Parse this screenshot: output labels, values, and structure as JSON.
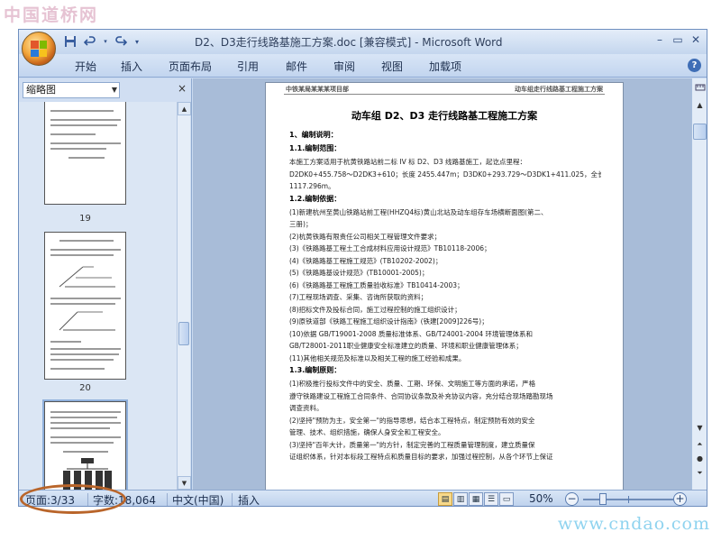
{
  "watermark_top": "中国道桥网",
  "watermark_bottom": "www.cndao.com",
  "window": {
    "title": "D2、D3走行线路基施工方案.doc [兼容模式] - Microsoft Word",
    "qat": {
      "save_icon": "save-icon",
      "undo_icon": "undo-icon",
      "redo_icon": "redo-icon",
      "customize_icon": "customize-qat-icon"
    },
    "controls": {
      "minimize": "–",
      "restore": "▭",
      "close": "✕"
    }
  },
  "ribbon": {
    "tabs": [
      "开始",
      "插入",
      "页面布局",
      "引用",
      "邮件",
      "审阅",
      "视图",
      "加载项"
    ],
    "help": "?"
  },
  "thumbnails": {
    "pane_title": "缩略图",
    "close": "×",
    "page_numbers": [
      "19",
      "20"
    ]
  },
  "document": {
    "header_left": "中铁某局某某某项目部",
    "header_right": "动车组走行线路基工程施工方案",
    "title": "动车组 D2、D3 走行线路基工程施工方案",
    "lines": [
      {
        "h": true,
        "text": "1、编制说明："
      },
      {
        "h": true,
        "text": "1.1.编制范围："
      },
      {
        "h": false,
        "text": "    本施工方案适用于杭黄铁路站前二标 IV 标 D2、D3 线路基施工，起讫点里程："
      },
      {
        "h": false,
        "text": "D2DK0+455.758～D2DK3+610；长度 2455.447m；D3DK0+293.729～D3DK1+411.025，全长"
      },
      {
        "h": false,
        "text": "1117.296m。"
      },
      {
        "h": true,
        "text": "1.2.编制依据："
      },
      {
        "h": false,
        "text": "    (1)新建杭州至黄山铁路站前工程(HHZQ4标)黄山北站及动车组存车场横断面图(第二、"
      },
      {
        "h": false,
        "text": "三册)；"
      },
      {
        "h": false,
        "text": "    (2)杭黄铁路有限责任公司相关工程管理文件要求；"
      },
      {
        "h": false,
        "text": "    (3)《铁路路基工程土工合成材料应用设计规范》TB10118-2006；"
      },
      {
        "h": false,
        "text": "    (4)《铁路路基工程施工规范》(TB10202-2002)；"
      },
      {
        "h": false,
        "text": "    (5)《铁路路基设计规范》(TB10001-2005)；"
      },
      {
        "h": false,
        "text": "    (6)《铁路路基工程施工质量验收标准》TB10414-2003；"
      },
      {
        "h": false,
        "text": "    (7)工程现场调查、采集、咨询所获取的资料；"
      },
      {
        "h": false,
        "text": "    (8)招标文件及投标合同，施工过程控制的施工组织设计；"
      },
      {
        "h": false,
        "text": "    (9)原铁道部《铁路工程施工组织设计指南》(铁建[2009]226号)；"
      },
      {
        "h": false,
        "text": "    (10)依据 GB/T19001-2008 质量标准体系、GB/T24001-2004 环境管理体系和"
      },
      {
        "h": false,
        "text": "GB/T28001-2011职业健康安全标准建立的质量、环境和职业健康管理体系；"
      },
      {
        "h": false,
        "text": "    (11)其他相关规范及标准以及相关工程的施工经验和成果。"
      },
      {
        "h": true,
        "text": "1.3.编制原则："
      },
      {
        "h": false,
        "text": "    (1)积极推行投标文件中的安全、质量、工期、环保、文明施工等方面的承诺，严格"
      },
      {
        "h": false,
        "text": "遵守铁路建设工程施工合同条件、合同协议条款及补充协议内容，充分结合现场踏勘现场"
      },
      {
        "h": false,
        "text": "调查资料。"
      },
      {
        "h": false,
        "text": "    (2)坚持\"预防为主，安全第一\"的指导思想，结合本工程特点，制定预防有效的安全"
      },
      {
        "h": false,
        "text": "管理、技术、组织措施，确保人身安全和工程安全。"
      },
      {
        "h": false,
        "text": "    (3)坚持\"百年大计，质量第一\"的方针，制定完善的工程质量管理制度，建立质量保"
      },
      {
        "h": false,
        "text": "证组织体系，针对本标段工程特点和质量目标的要求，加强过程控制，从各个环节上保证"
      }
    ]
  },
  "statusbar": {
    "page_label": "页面:",
    "page_value": "3/33",
    "words_label": "字数:",
    "words_value": "18,064",
    "language": "中文(中国)",
    "mode": "插入",
    "zoom_value": "50%",
    "zoom_minus": "−",
    "zoom_plus": "+",
    "zoom_level": 0.5
  }
}
